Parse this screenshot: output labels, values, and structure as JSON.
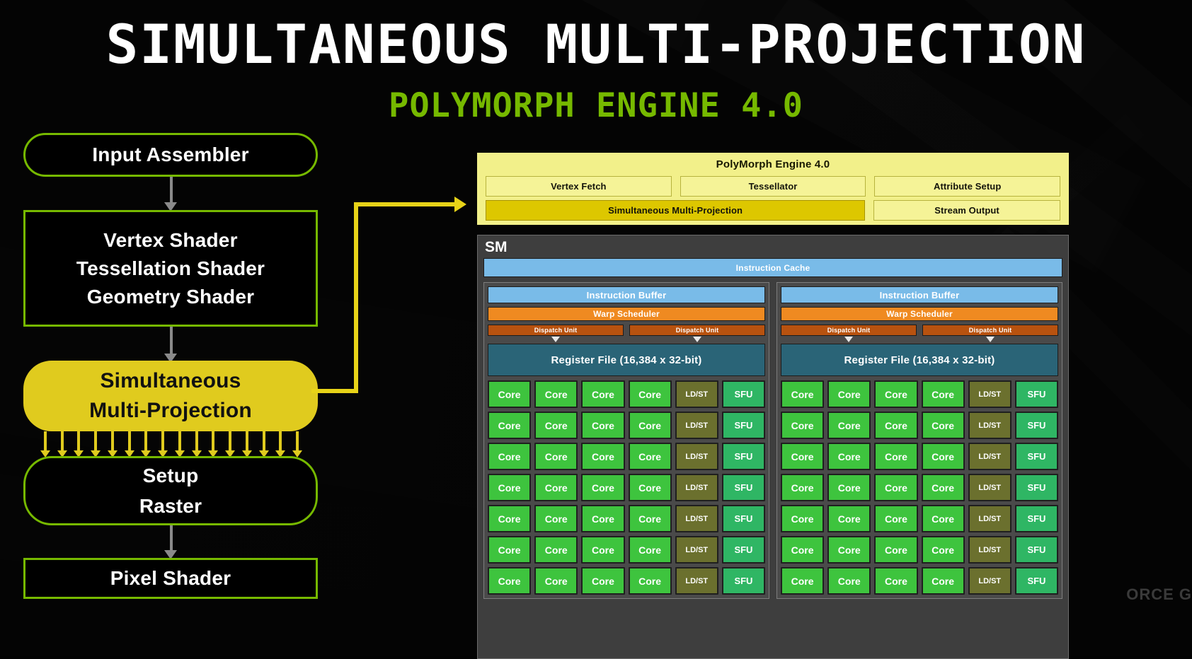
{
  "slide": {
    "title": "SIMULTANEOUS MULTI-PROJECTION",
    "subtitle": "POLYMORPH ENGINE 4.0",
    "watermark": "ORCE G",
    "accent_green": "#76b900",
    "accent_yellow": "#e0cb1e",
    "background": "#030303"
  },
  "pipeline": {
    "nodes": [
      {
        "label": "Input Assembler",
        "shape": "pill",
        "style": "outline"
      },
      {
        "label": "Vertex Shader\nTessellation Shader\nGeometry Shader",
        "shape": "rect",
        "style": "outline"
      },
      {
        "label": "Simultaneous\nMulti-Projection",
        "shape": "pill",
        "style": "filled-yellow"
      },
      {
        "label": "Setup\nRaster",
        "shape": "pill",
        "style": "outline"
      },
      {
        "label": "Pixel Shader",
        "shape": "rect",
        "style": "outline"
      }
    ],
    "fan_arrow_count": 16
  },
  "polymorph": {
    "title": "PolyMorph Engine 4.0",
    "row1": [
      "Vertex Fetch",
      "Tessellator",
      "Attribute Setup"
    ],
    "row2": [
      "Simultaneous Multi-Projection",
      "Stream Output"
    ],
    "highlight": "Simultaneous Multi-Projection",
    "fill": "#f2f08a",
    "highlight_fill": "#ddc700"
  },
  "sm": {
    "label": "SM",
    "instruction_cache": "Instruction Cache",
    "partitions": [
      {
        "instruction_buffer": "Instruction Buffer",
        "warp_scheduler": "Warp Scheduler",
        "dispatch_units": [
          "Dispatch Unit",
          "Dispatch Unit"
        ],
        "register_file": "Register File (16,384 x 32-bit)",
        "row_template": [
          "Core",
          "Core",
          "Core",
          "Core",
          "LD/ST",
          "SFU"
        ],
        "rows": 7
      },
      {
        "instruction_buffer": "Instruction Buffer",
        "warp_scheduler": "Warp Scheduler",
        "dispatch_units": [
          "Dispatch Unit",
          "Dispatch Unit"
        ],
        "register_file": "Register File (16,384 x 32-bit)",
        "row_template": [
          "Core",
          "Core",
          "Core",
          "Core",
          "LD/ST",
          "SFU"
        ],
        "rows": 7
      }
    ],
    "colors": {
      "core": "#3ec43e",
      "ldst": "#6b702e",
      "sfu": "#2fb664",
      "cache": "#79bbe8",
      "warp": "#ef8a21",
      "dispatch": "#b8520f",
      "register_file": "#2a6477",
      "panel": "#3e3e3e"
    }
  }
}
